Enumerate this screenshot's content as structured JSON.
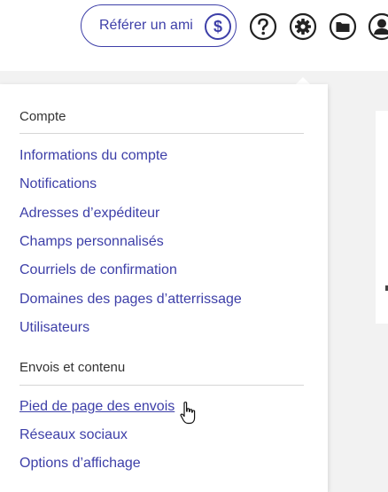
{
  "header": {
    "refer_label": "Référer un ami",
    "refer_badge": "$",
    "icons": [
      "help-icon",
      "gear-icon",
      "folder-icon",
      "user-avatar-icon"
    ]
  },
  "menu": {
    "sections": [
      {
        "title": "Compte",
        "items": [
          "Informations du compte",
          "Notifications",
          "Adresses d’expéditeur",
          "Champs personnalisés",
          "Courriels de confirmation",
          "Domaines des pages d’atterrissage",
          "Utilisateurs"
        ]
      },
      {
        "title": "Envois et contenu",
        "items": [
          "Pied de page des envois",
          "Réseaux sociaux",
          "Options d’affichage"
        ]
      }
    ],
    "hovered_item": "Pied de page des envois"
  },
  "colors": {
    "accent": "#3d3fa8",
    "icon": "#222222",
    "background": "#f2f2f2"
  }
}
